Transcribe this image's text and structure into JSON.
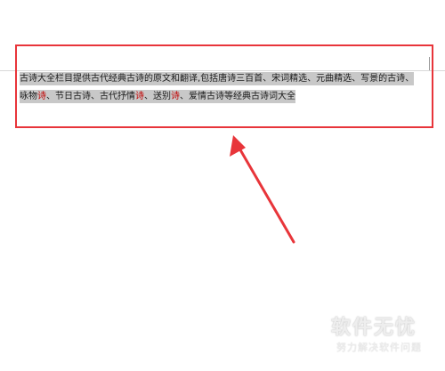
{
  "document": {
    "line1": {
      "text": "古诗大全栏目提供古代经典古诗的原文和翻译,包括唐诗三百首、宋词精选、元曲精选、写景的古诗、"
    },
    "line2": {
      "part1": "咏物",
      "red1": "诗",
      "part2": "、节日古诗、古代抒情",
      "red2": "诗",
      "part3": "、送别",
      "red3": "诗",
      "part4": "、爱情古诗等经典古诗词大全"
    },
    "text_color": "#1a1a1a",
    "selection_color": "#c8c8c8",
    "red_text_color": "#c00000"
  },
  "annotation": {
    "box_color": "#e8353a",
    "arrow_color": "#e8353a"
  },
  "watermark": {
    "title": "软件无忧",
    "subtitle": "努力解决软件问题"
  }
}
